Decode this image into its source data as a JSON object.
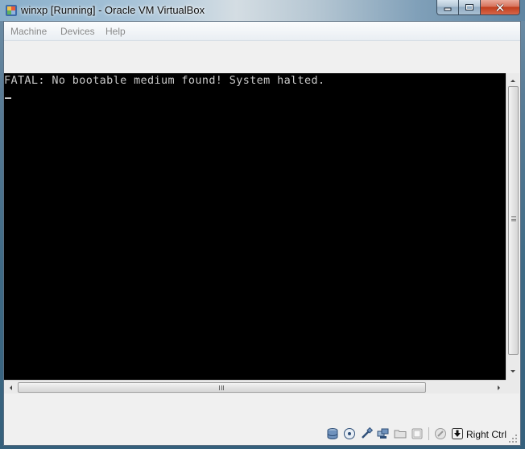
{
  "window": {
    "title": "winxp [Running] - Oracle VM VirtualBox",
    "controls": [
      "minimize",
      "maximize",
      "close"
    ]
  },
  "menu": {
    "items": [
      {
        "label": "Machine"
      },
      {
        "label": "Devices"
      },
      {
        "label": "Help"
      }
    ]
  },
  "console": {
    "line1": "FATAL: No bootable medium found! System halted.",
    "cursor": "_"
  },
  "statusbar": {
    "icons": [
      "hard-disk-icon",
      "optical-drive-icon",
      "usb-icon",
      "network-icon",
      "shared-folders-icon",
      "video-capture-icon",
      "mouse-integration-icon",
      "host-key-icon"
    ],
    "host_key_label": "Right Ctrl"
  },
  "colors": {
    "console_background": "#000000",
    "console_text": "#c8c8c8",
    "menu_text_disabled": "#8a8a8a",
    "close_button": "#c13d1c"
  }
}
